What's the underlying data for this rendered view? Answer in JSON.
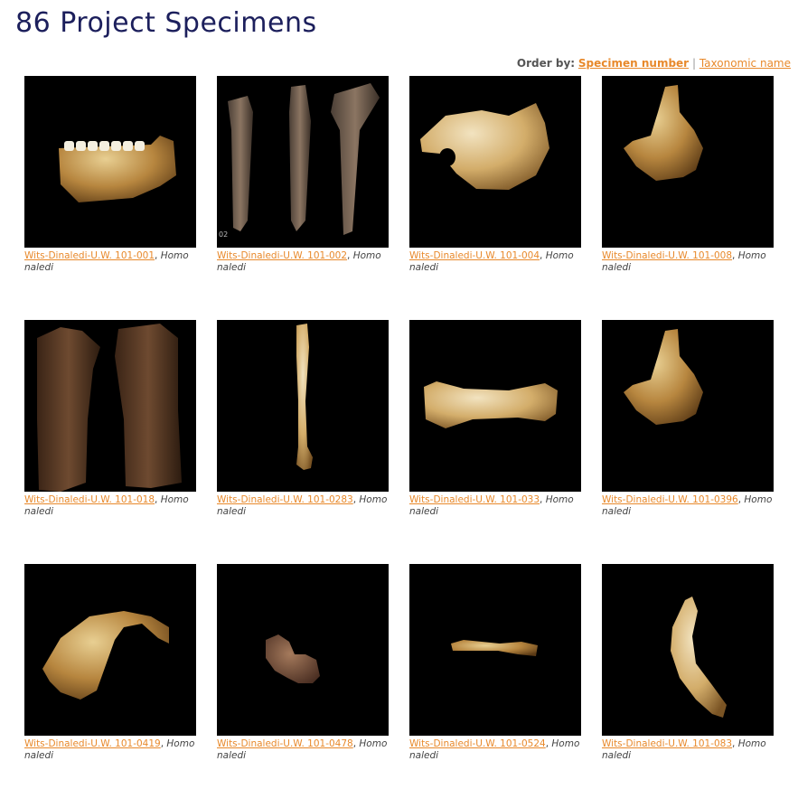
{
  "header": {
    "title": "86 Project Specimens"
  },
  "order": {
    "label": "Order by:",
    "options": [
      "Specimen number",
      "Taxonomic name"
    ],
    "separator": "|",
    "active_index": 0
  },
  "colors": {
    "title": "#1c1f5c",
    "link": "#e8892b",
    "image_bg": "#000000"
  },
  "specimens": [
    {
      "id": "Wits-Dinaledi-U.W. 101-001",
      "taxon": "Homo naledi",
      "image": "mandible-fragment"
    },
    {
      "id": "Wits-Dinaledi-U.W. 101-002",
      "taxon": "Homo naledi",
      "image": "long-bone-three-views",
      "image_label": "02"
    },
    {
      "id": "Wits-Dinaledi-U.W. 101-004",
      "taxon": "Homo naledi",
      "image": "temporal-fragment"
    },
    {
      "id": "Wits-Dinaledi-U.W. 101-008",
      "taxon": "Homo naledi",
      "image": "cranial-fragment"
    },
    {
      "id": "Wits-Dinaledi-U.W. 101-018",
      "taxon": "Homo naledi",
      "image": "bone-shaft-two-views"
    },
    {
      "id": "Wits-Dinaledi-U.W. 101-0283",
      "taxon": "Homo naledi",
      "image": "slender-long-bone"
    },
    {
      "id": "Wits-Dinaledi-U.W. 101-033",
      "taxon": "Homo naledi",
      "image": "metapodial-bone"
    },
    {
      "id": "Wits-Dinaledi-U.W. 101-0396",
      "taxon": "Homo naledi",
      "image": "cranial-fragment"
    },
    {
      "id": "Wits-Dinaledi-U.W. 101-0419",
      "taxon": "Homo naledi",
      "image": "curved-cranial-fragment"
    },
    {
      "id": "Wits-Dinaledi-U.W. 101-0478",
      "taxon": "Homo naledi",
      "image": "small-bone"
    },
    {
      "id": "Wits-Dinaledi-U.W. 101-0524",
      "taxon": "Homo naledi",
      "image": "phalanx"
    },
    {
      "id": "Wits-Dinaledi-U.W. 101-083",
      "taxon": "Homo naledi",
      "image": "curved-bone"
    }
  ]
}
